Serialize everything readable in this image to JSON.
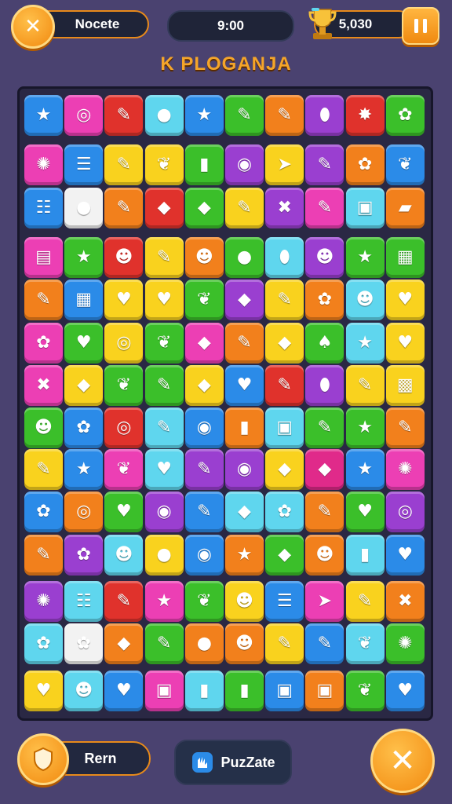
{
  "header": {
    "close_icon": "x-icon",
    "mode_label": "Nocete",
    "timer": "9:00",
    "trophy_icon": "trophy-icon",
    "score": "5,030",
    "pause_icon": "pause-icon"
  },
  "title": "K PLOGANJA",
  "colors": {
    "background": "#4a4270",
    "board": "#2a2844",
    "accent": "#f28a10",
    "blue": "#2b8be8",
    "pink": "#ec3fb4",
    "red": "#e0322c",
    "cyan": "#5fd6ee",
    "yellow": "#f9d21e",
    "green": "#3bbf2a",
    "orange": "#f2801c",
    "purple": "#9a3fd0",
    "magenta": "#e02a8a",
    "white": "#f2f2f2"
  },
  "board": {
    "rows": [
      [
        [
          "blue",
          "star-icon"
        ],
        [
          "pink",
          "swirl-icon"
        ],
        [
          "red",
          "pencil-icon"
        ],
        [
          "cyan",
          "blob-icon"
        ],
        [
          "blue",
          "star-icon"
        ],
        [
          "green",
          "pencil-icon"
        ],
        [
          "orange",
          "pencil-icon"
        ],
        [
          "purple",
          "drop-icon"
        ],
        [
          "red",
          "burst-icon"
        ],
        [
          "green",
          "flower-icon"
        ]
      ],
      [
        [
          "pink",
          "cookie-icon"
        ],
        [
          "blue",
          "lines-icon"
        ],
        [
          "yellow",
          "pencil-icon"
        ],
        [
          "yellow",
          "leaf-icon"
        ],
        [
          "green",
          "cup-icon"
        ],
        [
          "purple",
          "circle-icon"
        ],
        [
          "yellow",
          "arrow-icon"
        ],
        [
          "purple",
          "pencil-icon"
        ],
        [
          "orange",
          "flower-icon"
        ],
        [
          "blue",
          "leaf-icon"
        ]
      ],
      [
        [
          "blue",
          "list-icon"
        ],
        [
          "white",
          "blob-icon"
        ],
        [
          "orange",
          "pencil-icon"
        ],
        [
          "red",
          "gem-icon"
        ],
        [
          "green",
          "gem-icon"
        ],
        [
          "yellow",
          "pencil-icon"
        ],
        [
          "purple",
          "x-icon"
        ],
        [
          "pink",
          "pencil-icon"
        ],
        [
          "cyan",
          "jar-icon"
        ],
        [
          "orange",
          "scroll-icon"
        ]
      ],
      [
        [
          "pink",
          "box-icon"
        ],
        [
          "green",
          "star-icon"
        ],
        [
          "red",
          "face-icon"
        ],
        [
          "yellow",
          "pencil-icon"
        ],
        [
          "orange",
          "face-icon"
        ],
        [
          "green",
          "blob-icon"
        ],
        [
          "cyan",
          "drop-icon"
        ],
        [
          "purple",
          "face-icon"
        ],
        [
          "green",
          "star-icon"
        ],
        [
          "green",
          "clipboard-icon"
        ]
      ],
      [
        [
          "orange",
          "pencil-icon"
        ],
        [
          "blue",
          "clipboard-icon"
        ],
        [
          "yellow",
          "apple-icon"
        ],
        [
          "yellow",
          "apple-icon"
        ],
        [
          "green",
          "leaf-icon"
        ],
        [
          "purple",
          "gem-icon"
        ],
        [
          "yellow",
          "pencil-icon"
        ],
        [
          "orange",
          "flower-icon"
        ],
        [
          "cyan",
          "face-icon"
        ],
        [
          "yellow",
          "heart-icon"
        ]
      ],
      [
        [
          "pink",
          "flower-icon"
        ],
        [
          "green",
          "apple-icon"
        ],
        [
          "yellow",
          "swirl-icon"
        ],
        [
          "green",
          "leaf-icon"
        ],
        [
          "pink",
          "gem-icon"
        ],
        [
          "orange",
          "pencil-icon"
        ],
        [
          "yellow",
          "gem-icon"
        ],
        [
          "green",
          "bell-icon"
        ],
        [
          "cyan",
          "star-icon"
        ],
        [
          "yellow",
          "apple-icon"
        ]
      ],
      [
        [
          "pink",
          "x-icon"
        ],
        [
          "yellow",
          "gem-icon"
        ],
        [
          "green",
          "leaf-icon"
        ],
        [
          "green",
          "pencil-icon"
        ],
        [
          "yellow",
          "gem-icon"
        ],
        [
          "blue",
          "apple-icon"
        ],
        [
          "red",
          "pencil-icon"
        ],
        [
          "purple",
          "drop-icon"
        ],
        [
          "yellow",
          "pencil-icon"
        ],
        [
          "yellow",
          "bag-icon"
        ]
      ],
      [
        [
          "green",
          "face-icon"
        ],
        [
          "blue",
          "flower-icon"
        ],
        [
          "red",
          "swirl-icon"
        ],
        [
          "cyan",
          "pencil-icon"
        ],
        [
          "blue",
          "circle-icon"
        ],
        [
          "orange",
          "cup-icon"
        ],
        [
          "cyan",
          "jar-icon"
        ],
        [
          "green",
          "pencil-icon"
        ],
        [
          "green",
          "star-icon"
        ],
        [
          "orange",
          "pencil-icon"
        ]
      ],
      [
        [
          "yellow",
          "pencil-icon"
        ],
        [
          "blue",
          "star-icon"
        ],
        [
          "pink",
          "leaf-icon"
        ],
        [
          "cyan",
          "apple-icon"
        ],
        [
          "purple",
          "pencil-icon"
        ],
        [
          "purple",
          "circle-icon"
        ],
        [
          "yellow",
          "gem-icon"
        ],
        [
          "magenta",
          "gem-icon"
        ],
        [
          "blue",
          "star-icon"
        ],
        [
          "pink",
          "cookie-icon"
        ]
      ],
      [
        [
          "blue",
          "flower-icon"
        ],
        [
          "orange",
          "swirl-icon"
        ],
        [
          "green",
          "apple-icon"
        ],
        [
          "purple",
          "circle-icon"
        ],
        [
          "blue",
          "pencil-icon"
        ],
        [
          "cyan",
          "gem-icon"
        ],
        [
          "cyan",
          "flower-icon"
        ],
        [
          "orange",
          "pencil-icon"
        ],
        [
          "green",
          "heart-icon"
        ],
        [
          "purple",
          "swirl-icon"
        ]
      ],
      [
        [
          "orange",
          "pencil-icon"
        ],
        [
          "purple",
          "flower-icon"
        ],
        [
          "cyan",
          "face-icon"
        ],
        [
          "yellow",
          "blob-icon"
        ],
        [
          "blue",
          "circle-icon"
        ],
        [
          "orange",
          "star-icon"
        ],
        [
          "green",
          "gem-icon"
        ],
        [
          "orange",
          "face-icon"
        ],
        [
          "cyan",
          "cup-icon"
        ],
        [
          "blue",
          "apple-icon"
        ]
      ],
      [
        [
          "purple",
          "cookie-icon"
        ],
        [
          "cyan",
          "list-icon"
        ],
        [
          "red",
          "pencil-icon"
        ],
        [
          "pink",
          "star-icon"
        ],
        [
          "green",
          "leaf-icon"
        ],
        [
          "yellow",
          "face-icon"
        ],
        [
          "blue",
          "lines-icon"
        ],
        [
          "pink",
          "arrow-icon"
        ],
        [
          "yellow",
          "pencil-icon"
        ],
        [
          "orange",
          "x-icon"
        ]
      ],
      [
        [
          "cyan",
          "flower-icon"
        ],
        [
          "white",
          "flower-icon"
        ],
        [
          "orange",
          "gem-icon"
        ],
        [
          "green",
          "pencil-icon"
        ],
        [
          "orange",
          "blob-icon"
        ],
        [
          "orange",
          "face-icon"
        ],
        [
          "yellow",
          "pencil-icon"
        ],
        [
          "blue",
          "pencil-icon"
        ],
        [
          "cyan",
          "leaf-icon"
        ],
        [
          "green",
          "cookie-icon"
        ]
      ],
      [
        [
          "yellow",
          "apple-icon"
        ],
        [
          "cyan",
          "face-icon"
        ],
        [
          "blue",
          "apple-icon"
        ],
        [
          "pink",
          "jar-icon"
        ],
        [
          "cyan",
          "cup-icon"
        ],
        [
          "green",
          "cup-icon"
        ],
        [
          "blue",
          "jar-icon"
        ],
        [
          "orange",
          "jar-icon"
        ],
        [
          "green",
          "leaf-icon"
        ],
        [
          "blue",
          "heart-icon"
        ]
      ]
    ]
  },
  "glyphs": {
    "star-icon": "★",
    "swirl-icon": "◎",
    "pencil-icon": "✎",
    "blob-icon": "●",
    "flower-icon": "✿",
    "cookie-icon": "✺",
    "lines-icon": "☰",
    "leaf-icon": "❦",
    "cup-icon": "▮",
    "circle-icon": "◉",
    "arrow-icon": "➤",
    "drop-icon": "⬮",
    "burst-icon": "✸",
    "list-icon": "☷",
    "gem-icon": "◆",
    "x-icon": "✖",
    "jar-icon": "▣",
    "scroll-icon": "▰",
    "box-icon": "▤",
    "face-icon": "☻",
    "clipboard-icon": "▦",
    "apple-icon": "♥",
    "heart-icon": "♥",
    "bell-icon": "♠",
    "bag-icon": "▩"
  },
  "footer": {
    "left_icon": "shield-icon",
    "left_label": "Rern",
    "middle_icon": "hand-icon",
    "middle_label": "PuzZate",
    "right_icon": "x-icon"
  }
}
